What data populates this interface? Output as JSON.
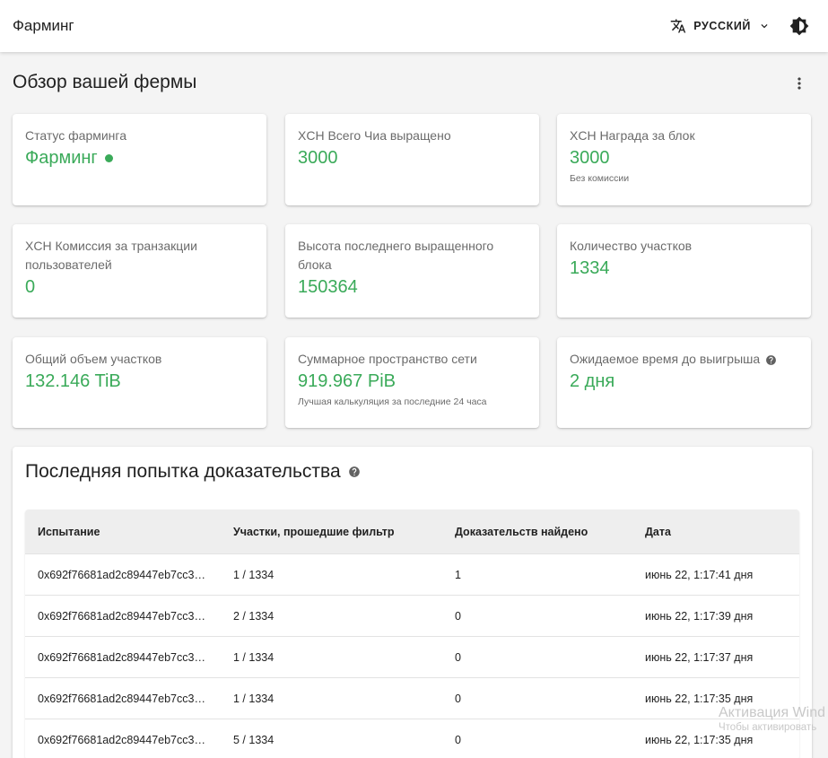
{
  "appbar": {
    "title": "Фарминг",
    "language": "РУССКИЙ"
  },
  "page": {
    "title": "Обзор вашей фермы"
  },
  "cards": {
    "status": {
      "label": "Статус фарминга",
      "value": "Фарминг"
    },
    "total_farmed": {
      "label": "XCH Всего Чиа выращено",
      "value": "3000"
    },
    "block_reward": {
      "label": "XCH Награда за блок",
      "value": "3000",
      "sub": "Без комиссии"
    },
    "tx_fees": {
      "label": "XCH Комиссия за транзакции пользователей",
      "value": "0"
    },
    "last_height": {
      "label": "Высота последнего выращенного блока",
      "value": "150364"
    },
    "plot_count": {
      "label": "Количество участков",
      "value": "1334"
    },
    "total_size": {
      "label": "Общий объем участков",
      "value": "132.146 TiB"
    },
    "netspace": {
      "label": "Суммарное пространство сети",
      "value": "919.967 PiB",
      "sub": "Лучшая калькуляция за последние 24 часа"
    },
    "time_to_win": {
      "label": "Ожидаемое время до выигрыша",
      "value": "2 дня"
    }
  },
  "proofs": {
    "title": "Последняя попытка доказательства",
    "columns": [
      "Испытание",
      "Участки, прошедшие фильтр",
      "Доказательств найдено",
      "Дата"
    ],
    "rows": [
      [
        "0x692f76681ad2c89447eb7cc3…",
        "1 / 1334",
        "1",
        "июнь 22, 1:17:41 дня"
      ],
      [
        "0x692f76681ad2c89447eb7cc3…",
        "2 / 1334",
        "0",
        "июнь 22, 1:17:39 дня"
      ],
      [
        "0x692f76681ad2c89447eb7cc3…",
        "1 / 1334",
        "0",
        "июнь 22, 1:17:37 дня"
      ],
      [
        "0x692f76681ad2c89447eb7cc3…",
        "1 / 1334",
        "0",
        "июнь 22, 1:17:35 дня"
      ],
      [
        "0x692f76681ad2c89447eb7cc3…",
        "5 / 1334",
        "0",
        "июнь 22, 1:17:35 дня"
      ]
    ]
  },
  "watermark": {
    "line1": "Активация Wind",
    "line2": "Чтобы активировать"
  },
  "colors": {
    "accent_green": "#3aaa59",
    "background": "#f4f4f4",
    "card": "#ffffff",
    "table_header": "#eeeeee"
  }
}
